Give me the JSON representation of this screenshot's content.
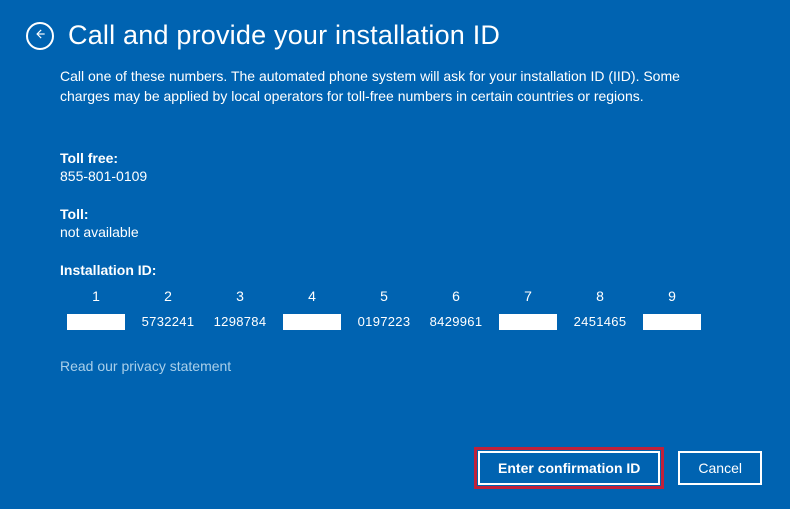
{
  "title": "Call and provide your installation ID",
  "intro": "Call one of these numbers. The automated phone system will ask for your installation ID (IID). Some charges may be applied by local operators for toll-free numbers in certain countries or regions.",
  "toll_free": {
    "label": "Toll free:",
    "value": "855-801-0109"
  },
  "toll": {
    "label": "Toll:",
    "value": "not available"
  },
  "installation_id": {
    "label": "Installation ID:",
    "columns": [
      "1",
      "2",
      "3",
      "4",
      "5",
      "6",
      "7",
      "8",
      "9"
    ],
    "values": [
      "",
      "5732241",
      "1298784",
      "",
      "0197223",
      "8429961",
      "",
      "2451465",
      ""
    ]
  },
  "privacy_link": "Read our privacy statement",
  "buttons": {
    "enter_confirmation": "Enter confirmation ID",
    "cancel": "Cancel"
  }
}
